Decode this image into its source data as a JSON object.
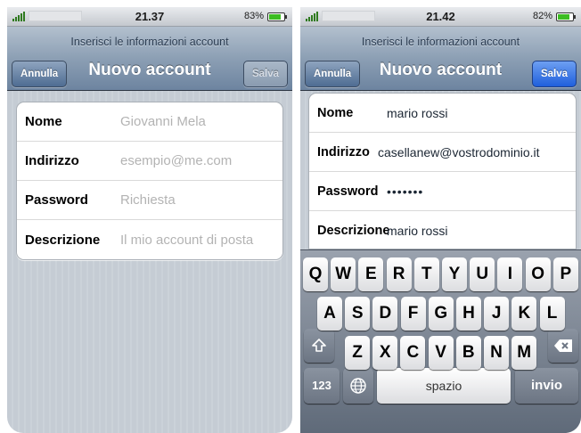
{
  "left": {
    "status": {
      "time": "21.37",
      "battery": "83%",
      "battery_level": 0.83
    },
    "nav": {
      "prompt": "Inserisci le informazioni account",
      "title": "Nuovo account",
      "cancel": "Annulla",
      "save": "Salva"
    },
    "fields": [
      {
        "label": "Nome",
        "placeholder": "Giovanni Mela"
      },
      {
        "label": "Indirizzo",
        "placeholder": "esempio@me.com"
      },
      {
        "label": "Password",
        "placeholder": "Richiesta"
      },
      {
        "label": "Descrizione",
        "placeholder": "Il mio account di posta"
      }
    ]
  },
  "right": {
    "status": {
      "time": "21.42",
      "battery": "82%",
      "battery_level": 0.82
    },
    "nav": {
      "prompt": "Inserisci le informazioni account",
      "title": "Nuovo account",
      "cancel": "Annulla",
      "save": "Salva"
    },
    "fields": [
      {
        "label": "Nome",
        "value": "mario rossi"
      },
      {
        "label": "Indirizzo",
        "value": "casellanew@vostrodominio.it"
      },
      {
        "label": "Password",
        "value": "•••••••"
      },
      {
        "label": "Descrizione",
        "value": "mario rossi"
      }
    ],
    "keyboard": {
      "row1": [
        "Q",
        "W",
        "E",
        "R",
        "T",
        "Y",
        "U",
        "I",
        "O",
        "P"
      ],
      "row2": [
        "A",
        "S",
        "D",
        "F",
        "G",
        "H",
        "J",
        "K",
        "L"
      ],
      "row3": [
        "Z",
        "X",
        "C",
        "V",
        "B",
        "N",
        "M"
      ],
      "numbers_key": "123",
      "space_key": "spazio",
      "enter_key": "invio",
      "shift_icon": "shift-icon",
      "backspace_icon": "backspace-icon",
      "globe_icon": "globe-icon"
    }
  },
  "colors": {
    "save_enabled": "#1f5fdc",
    "navbar": "#8c9fb4",
    "battery": "#3cbd22"
  }
}
